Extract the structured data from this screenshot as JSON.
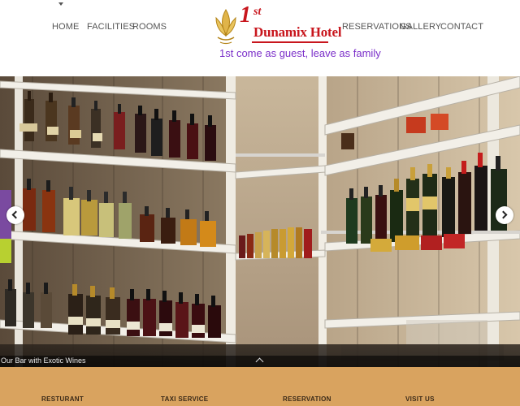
{
  "nav": {
    "left": [
      "HOME",
      "FACILITIES",
      "ROOMS"
    ],
    "right": [
      "RESERVATIONS",
      "GALLERY",
      "CONTACT"
    ]
  },
  "logo": {
    "number": "1",
    "ordinal_suffix": "st",
    "name": "Dunamix Hotel",
    "tagline": "1st come as guest, leave as family"
  },
  "slider": {
    "caption": "Our Bar with Exotic Wines"
  },
  "footer": {
    "columns": [
      "RESTURANT",
      "TAXI SERVICE",
      "RESERVATION",
      "VISIT US"
    ]
  },
  "colors": {
    "brand_red": "#c8161d",
    "tagline_purple": "#7b2fc9",
    "footer_bg": "#d9a35f"
  }
}
